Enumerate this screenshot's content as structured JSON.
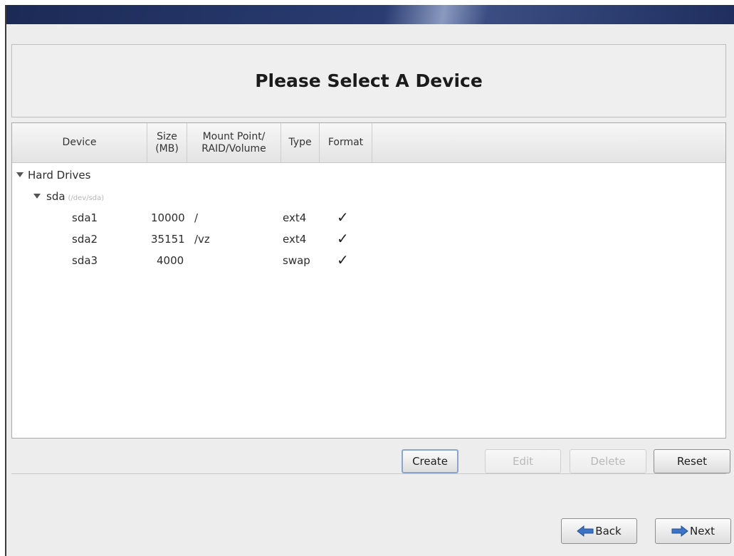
{
  "header": {
    "title": "Please Select A Device"
  },
  "columns": [
    {
      "lines": [
        "Device"
      ]
    },
    {
      "lines": [
        "Size",
        "(MB)"
      ]
    },
    {
      "lines": [
        "Mount Point/",
        "RAID/Volume"
      ]
    },
    {
      "lines": [
        "Type"
      ]
    },
    {
      "lines": [
        "Format"
      ]
    }
  ],
  "tree": {
    "root": {
      "label": "Hard Drives"
    },
    "disk": {
      "label": "sda",
      "hint": "(/dev/sda)"
    },
    "partitions": [
      {
        "device": "sda1",
        "size": "10000",
        "mount": "/",
        "type": "ext4",
        "format": "✓"
      },
      {
        "device": "sda2",
        "size": "35151",
        "mount": "/vz",
        "type": "ext4",
        "format": "✓"
      },
      {
        "device": "sda3",
        "size": "4000",
        "mount": "",
        "type": "swap",
        "format": "✓"
      }
    ]
  },
  "actions": {
    "create": "Create",
    "edit": "Edit",
    "delete": "Delete",
    "reset": "Reset"
  },
  "nav": {
    "back": "Back",
    "next": "Next"
  },
  "colors": {
    "banner": "#1c2a56",
    "background": "#ededed",
    "default_button_border": "#8aa6cf",
    "nav_arrow": "#3b73c7"
  }
}
